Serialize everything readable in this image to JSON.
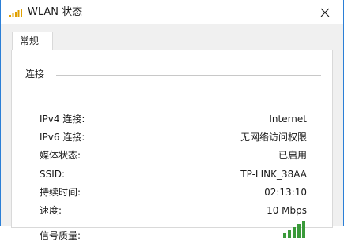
{
  "window": {
    "title": "WLAN 状态",
    "title_icon": "wifi-signal-bars-icon",
    "close_icon": "close-icon",
    "accent_color": "#2b7fd6"
  },
  "tabs": [
    {
      "label": "常规",
      "selected": true
    }
  ],
  "connection": {
    "group_label": "连接",
    "rows": [
      {
        "label": "IPv4 连接:",
        "value": "Internet"
      },
      {
        "label": "IPv6 连接:",
        "value": "无网络访问权限"
      },
      {
        "label": "媒体状态:",
        "value": "已启用"
      },
      {
        "label": "SSID:",
        "value": "TP-LINK_38AA"
      },
      {
        "label": "持续时间:",
        "value": "02:13:10"
      },
      {
        "label": "速度:",
        "value": "10 Mbps"
      }
    ],
    "signal": {
      "label": "信号质量:",
      "icon": "signal-strength-icon",
      "bars_lit": 5,
      "bars_total": 5,
      "color": "#3a9a3a"
    }
  }
}
